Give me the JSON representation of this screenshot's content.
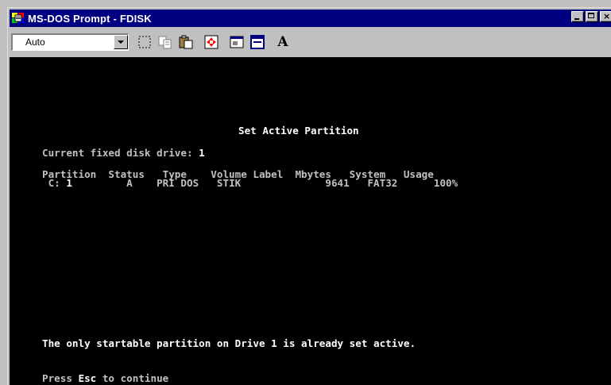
{
  "window": {
    "title": "MS-DOS Prompt - FDISK"
  },
  "toolbar": {
    "font_value": "Auto",
    "buttons": [
      "mark-icon",
      "copy-icon",
      "paste-icon",
      "fullscreen-icon",
      "properties-icon",
      "background-icon",
      "font-icon"
    ]
  },
  "console": {
    "heading": "Set Active Partition",
    "drive_label": "Current fixed disk drive: ",
    "drive_num": "1",
    "col_headers": "Partition  Status   Type    Volume Label  Mbytes   System   Usage",
    "row_prefix": " C: ",
    "row_num": "1",
    "row_rest": "         A    PRI DOS   STIK              9641   FAT32      100%",
    "message": "The only startable partition on Drive 1 is already set active.",
    "press": "Press ",
    "esc": "Esc",
    "continue": " to continue"
  }
}
